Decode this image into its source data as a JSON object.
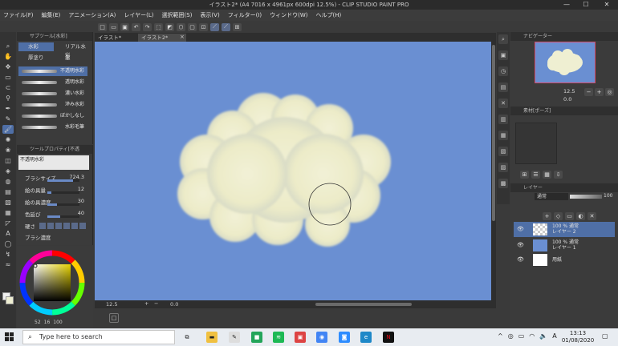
{
  "window": {
    "title": "イラスト2* (A4 7016 x 4961px 600dpi 12.5%) - CLIP STUDIO PAINT PRO",
    "controls": [
      "—",
      "☐",
      "✕"
    ]
  },
  "menu": [
    "ファイル(F)",
    "編集(E)",
    "アニメーション(A)",
    "レイヤー(L)",
    "選択範囲(S)",
    "表示(V)",
    "フィルター(I)",
    "ウィンドウ(W)",
    "ヘルプ(H)"
  ],
  "subtool_panel": {
    "title": "サブツール[水彩]",
    "tabs": [
      "水彩",
      "リアル水彩",
      "厚塗り",
      "墨"
    ],
    "active_tab": "水彩",
    "brushes": [
      "不透明水彩",
      "透明水彩",
      "濃い水彩",
      "滲み水彩",
      "ぼかしなし",
      "水彩毛筆"
    ],
    "active_brush": "不透明水彩"
  },
  "tool_property": {
    "title": "ツールプロパティ[不透",
    "brush_name": "不透明水彩",
    "rows": [
      {
        "label": "ブラシサイズ",
        "value": "724.3",
        "level": 0.8
      },
      {
        "label": "絵の具量",
        "value": "12",
        "level": 0.12
      },
      {
        "label": "絵の具濃度",
        "value": "30",
        "level": 0.3
      },
      {
        "label": "色延び",
        "value": "40",
        "level": 0.4
      },
      {
        "label": "硬さ",
        "value": ""
      },
      {
        "label": "ブラシ濃度",
        "value": ""
      }
    ]
  },
  "color": {
    "readout": [
      "52",
      "16",
      "100"
    ]
  },
  "canvas_tabs": [
    {
      "label": "イラスト*"
    },
    {
      "label": "イラスト2*"
    }
  ],
  "status": {
    "zoom": "12.5",
    "rotation": "0.0"
  },
  "navigator": {
    "title": "ナビゲーター",
    "zoom": "12.5",
    "rotation": "0.0"
  },
  "material": {
    "title": "素材[ポーズ]"
  },
  "layers": {
    "title": "レイヤー",
    "blend_mode": "通常",
    "opacity": "100",
    "items": [
      {
        "top": "100 % 通常",
        "name": "レイヤー 2",
        "active": true
      },
      {
        "top": "100 % 通常",
        "name": "レイヤー 1",
        "active": false
      },
      {
        "top": "",
        "name": "用紙",
        "active": false
      }
    ]
  },
  "taskbar": {
    "search_placeholder": "Type here to search",
    "time": "13:13",
    "date": "01/08/2020"
  },
  "colors": {
    "canvas_bg": "#6a8fd2",
    "cloud": "#efefd2",
    "accent": "#4f6fa6"
  }
}
